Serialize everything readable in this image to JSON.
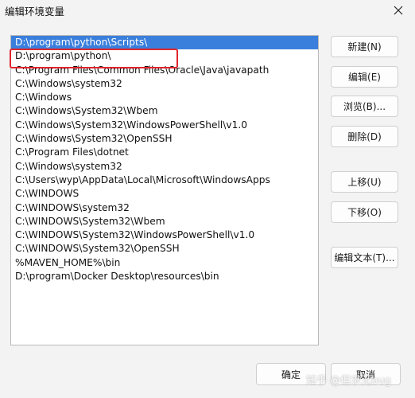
{
  "window": {
    "title": "编辑环境变量"
  },
  "list": {
    "selected_index": 0,
    "items": [
      "D:\\program\\python\\Scripts\\",
      "D:\\program\\python\\",
      "C:\\Program Files\\Common Files\\Oracle\\Java\\javapath",
      "C:\\Windows\\system32",
      "C:\\Windows",
      "C:\\Windows\\System32\\Wbem",
      "C:\\Windows\\System32\\WindowsPowerShell\\v1.0",
      "C:\\Windows\\System32\\OpenSSH",
      "C:\\Program Files\\dotnet",
      "C:\\Windows\\system32",
      "C:\\Users\\wyp\\AppData\\Local\\Microsoft\\WindowsApps",
      "C:\\WINDOWS",
      "C:\\WINDOWS\\system32",
      "C:\\WINDOWS\\System32\\Wbem",
      "C:\\WINDOWS\\System32\\WindowsPowerShell\\v1.0",
      "C:\\WINDOWS\\System32\\OpenSSH",
      "%MAVEN_HOME%\\bin",
      "D:\\program\\Docker Desktop\\resources\\bin"
    ]
  },
  "buttons": {
    "new": "新建(N)",
    "edit": "编辑(E)",
    "browse": "浏览(B)...",
    "delete": "删除(D)",
    "move_up": "上移(U)",
    "move_down": "下移(O)",
    "edit_text": "编辑文本(T)...",
    "ok": "确定",
    "cancel": "取消"
  },
  "watermark": "知乎 @但求无bug",
  "colors": {
    "selection": "#3a7fdc",
    "highlight_box": "#e0262c"
  },
  "icons": {
    "close": "close-icon"
  }
}
